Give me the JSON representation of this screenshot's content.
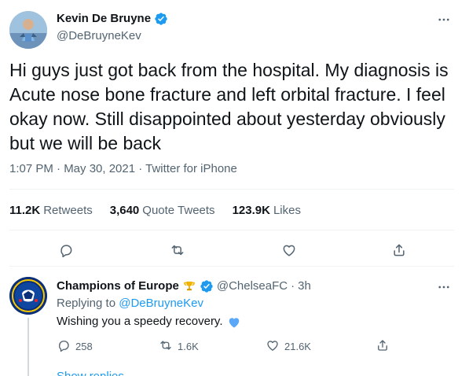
{
  "tweet": {
    "author": {
      "name": "Kevin De Bruyne",
      "handle": "@DeBruyneKev",
      "verified": true
    },
    "text": "Hi guys just got back from the hospital. My diagnosis is Acute nose bone fracture and left orbital fracture. I feel okay now. Still disappointed about yesterday obviously but we will be back",
    "meta": "1:07 PM · May 30, 2021 · Twitter for iPhone",
    "stats": {
      "retweets_value": "11.2K",
      "retweets_label": "Retweets",
      "quote_tweets_value": "3,640",
      "quote_tweets_label": "Quote Tweets",
      "likes_value": "123.9K",
      "likes_label": "Likes"
    },
    "actions": [
      "reply-icon",
      "retweet-icon",
      "like-icon",
      "share-icon"
    ]
  },
  "reply": {
    "author": {
      "name": "Champions of Europe",
      "handle": "@ChelseaFC",
      "separator": "·",
      "time": "3h",
      "verified": true
    },
    "replying_to_label": "Replying to",
    "replying_to_handle": "@DeBruyneKev",
    "text": "Wishing you a speedy recovery.",
    "counts": {
      "replies": "258",
      "retweets": "1.6K",
      "likes": "21.6K"
    },
    "show_replies_label": "Show replies",
    "actions": [
      "reply-icon",
      "retweet-icon",
      "like-icon",
      "share-icon"
    ]
  },
  "ui": {
    "more_icon": "more-icon",
    "accent_color": "#1d9bf0",
    "secondary_text_color": "#536471",
    "divider_color": "#eff3f4",
    "heart_emoji_color": "#5aa8f7"
  }
}
